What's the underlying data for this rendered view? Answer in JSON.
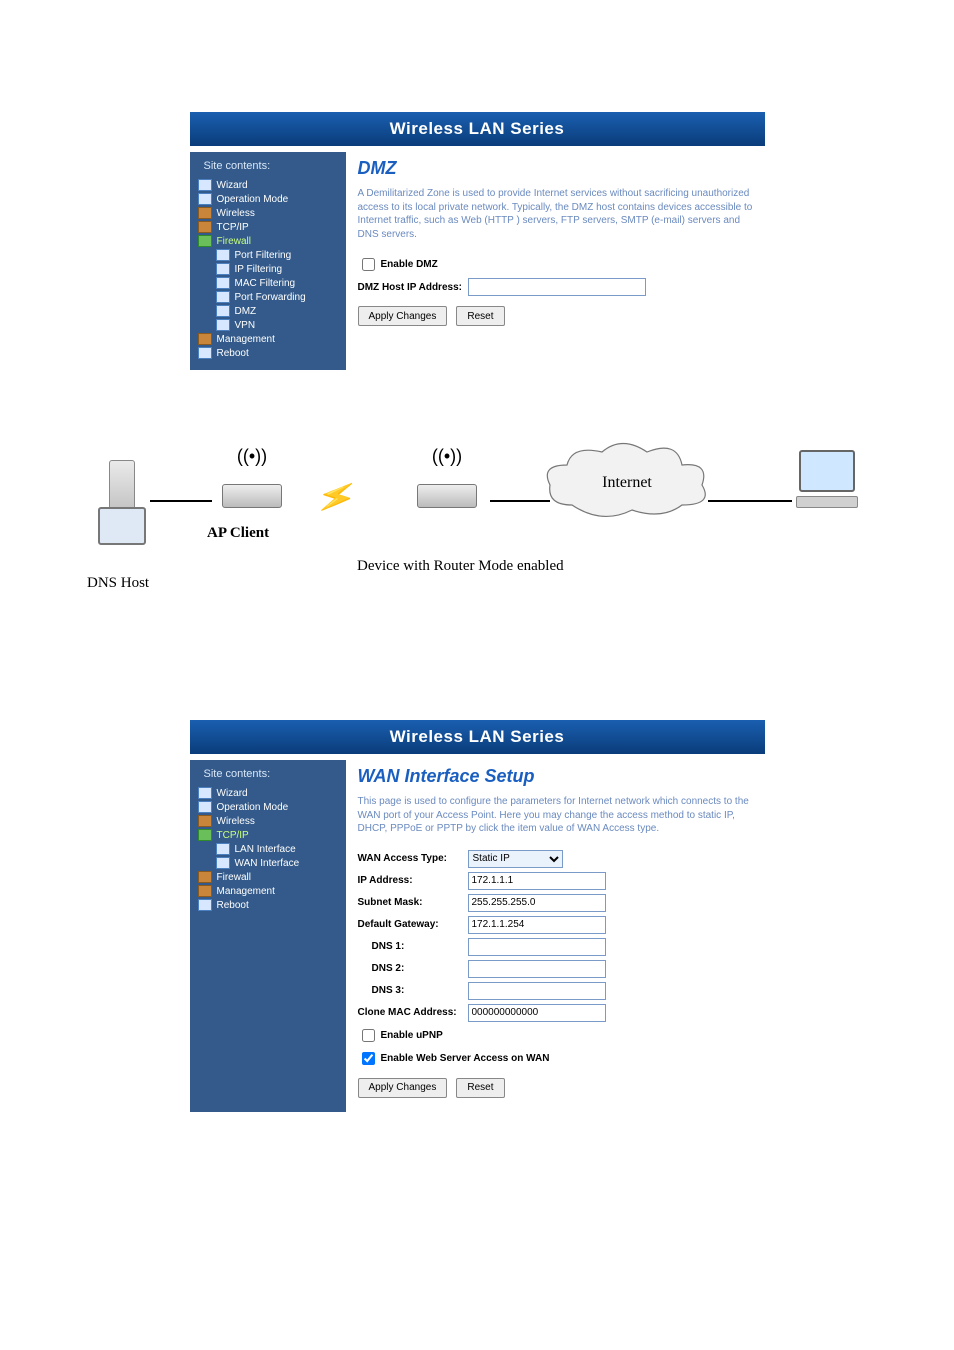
{
  "panel1": {
    "title": "Wireless LAN Series",
    "sidebar_heading": "Site contents:",
    "tree": {
      "wizard": "Wizard",
      "opmode": "Operation Mode",
      "wireless": "Wireless",
      "tcpip": "TCP/IP",
      "firewall": "Firewall",
      "port_filtering": "Port Filtering",
      "ip_filtering": "IP Filtering",
      "mac_filtering": "MAC Filtering",
      "port_forwarding": "Port Forwarding",
      "dmz": "DMZ",
      "vpn": "VPN",
      "management": "Management",
      "reboot": "Reboot"
    },
    "heading": "DMZ",
    "description": "A Demilitarized Zone is used to provide Internet services without sacrificing unauthorized access to its local private network. Typically, the DMZ host contains devices accessible to Internet traffic, such as Web (HTTP ) servers, FTP servers, SMTP (e-mail) servers and DNS servers.",
    "enable_dmz_label": "Enable DMZ",
    "dmz_host_label": "DMZ Host IP Address:",
    "dmz_host_value": "",
    "apply_btn": "Apply Changes",
    "reset_btn": "Reset"
  },
  "diagram": {
    "dns_host": "DNS Host",
    "ap_client": "AP Client",
    "device_caption": "Device with Router Mode enabled",
    "internet": "Internet"
  },
  "panel2": {
    "title": "Wireless LAN Series",
    "sidebar_heading": "Site contents:",
    "tree": {
      "wizard": "Wizard",
      "opmode": "Operation Mode",
      "wireless": "Wireless",
      "tcpip": "TCP/IP",
      "lan_if": "LAN Interface",
      "wan_if": "WAN Interface",
      "firewall": "Firewall",
      "management": "Management",
      "reboot": "Reboot"
    },
    "heading": "WAN Interface Setup",
    "description": "This page is used to configure the parameters for Internet network which connects to the WAN port of your Access Point. Here you may change the access method to static IP, DHCP, PPPoE or PPTP by click the item value of WAN Access type.",
    "fields": {
      "wan_access_type_label": "WAN Access Type:",
      "wan_access_type_value": "Static IP",
      "ip_label": "IP Address:",
      "ip_value": "172.1.1.1",
      "mask_label": "Subnet Mask:",
      "mask_value": "255.255.255.0",
      "gw_label": "Default Gateway:",
      "gw_value": "172.1.1.254",
      "dns1_label": "DNS 1:",
      "dns1_value": "",
      "dns2_label": "DNS 2:",
      "dns2_value": "",
      "dns3_label": "DNS 3:",
      "dns3_value": "",
      "clone_mac_label": "Clone MAC Address:",
      "clone_mac_value": "000000000000",
      "upnp_label": "Enable uPNP",
      "webserver_label": "Enable Web Server Access on WAN"
    },
    "apply_btn": "Apply Changes",
    "reset_btn": "Reset"
  }
}
